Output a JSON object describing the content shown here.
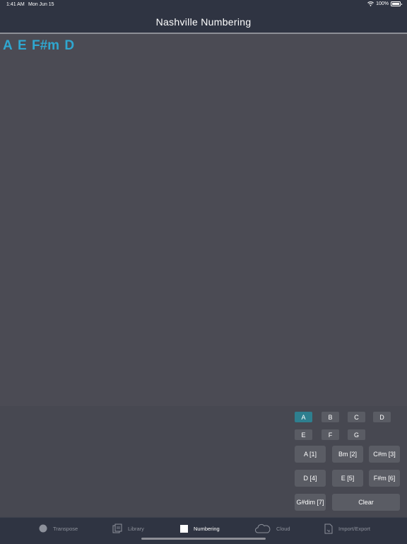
{
  "status_bar": {
    "time": "1:41 AM",
    "date": "Mon Jun 15",
    "battery": "100%",
    "icons": [
      "wifi-icon",
      "battery-icon"
    ]
  },
  "nav": {
    "title": "Nashville Numbering"
  },
  "chords": [
    "A",
    "E",
    "F#m",
    "D"
  ],
  "keys": {
    "selected": "A",
    "row1": [
      "A",
      "B",
      "C",
      "D"
    ],
    "row2": [
      "E",
      "F",
      "G"
    ]
  },
  "chord_buttons": {
    "row1": [
      "A [1]",
      "Bm [2]",
      "C#m [3]"
    ],
    "row2": [
      "D [4]",
      "E [5]",
      "F#m [6]"
    ],
    "row3": [
      "G#dim [7]"
    ],
    "clear": "Clear"
  },
  "tabs": {
    "active": "Numbering",
    "items": [
      {
        "label": "Transpose",
        "icon": "circle-icon"
      },
      {
        "label": "Library",
        "icon": "library-icon"
      },
      {
        "label": "Numbering",
        "icon": "square-icon"
      },
      {
        "label": "Cloud",
        "icon": "cloud-icon"
      },
      {
        "label": "Import/Export",
        "icon": "document-icon"
      }
    ]
  },
  "colors": {
    "background": "#4b4b54",
    "bar": "#2f3442",
    "chord_text": "#2fa7d0",
    "key_selected": "#2e7f8f",
    "button": "#5a5c64"
  }
}
